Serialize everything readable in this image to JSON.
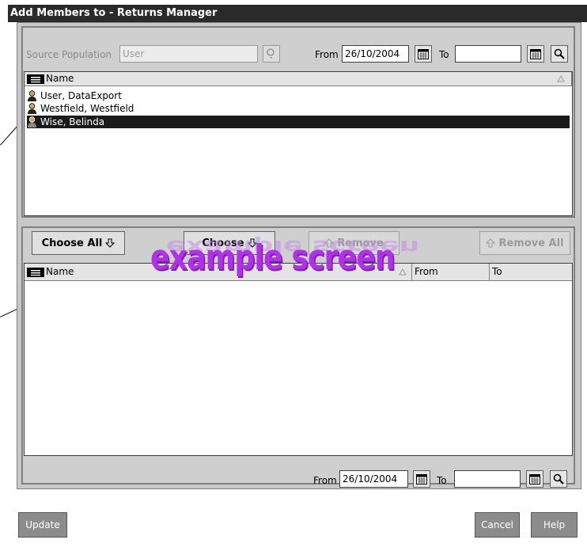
{
  "window": {
    "title": "Add Members to - Returns Manager"
  },
  "source": {
    "label": "Source Population",
    "value": "User",
    "from_label": "From",
    "from_value": "26/10/2004",
    "to_label": "To",
    "to_value": ""
  },
  "top_list": {
    "header": "Name",
    "rows": [
      {
        "name": "User, DataExport",
        "selected": false
      },
      {
        "name": "Westfield, Westfield",
        "selected": false
      },
      {
        "name": "Wise, Belinda",
        "selected": true
      }
    ]
  },
  "actions": {
    "choose_all": "Choose All",
    "choose": "Choose",
    "remove": "Remove",
    "remove_all": "Remove All"
  },
  "bottom_list": {
    "headers": {
      "name": "Name",
      "from": "From",
      "to": "To"
    }
  },
  "watermark": "example screen",
  "bottom_dates": {
    "from_label": "From",
    "from_value": "26/10/2004",
    "to_label": "To",
    "to_value": ""
  },
  "footer": {
    "update": "Update",
    "cancel": "Cancel",
    "help": "Help"
  },
  "colors": {
    "title_bar": "#2a2a2a",
    "selection": "#1a1a1a",
    "watermark": "#b230e8"
  }
}
